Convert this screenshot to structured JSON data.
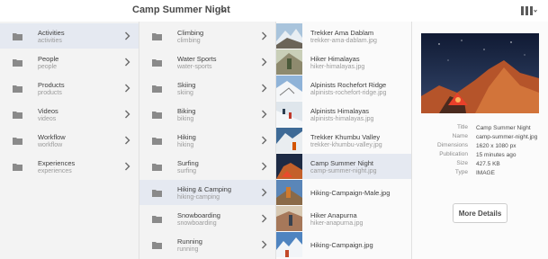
{
  "header": {
    "title": "Camp Summer Night"
  },
  "column1": [
    {
      "title": "Activities",
      "name": "activities",
      "selected": true
    },
    {
      "title": "People",
      "name": "people"
    },
    {
      "title": "Products",
      "name": "products"
    },
    {
      "title": "Videos",
      "name": "videos"
    },
    {
      "title": "Workflow",
      "name": "workflow"
    },
    {
      "title": "Experiences",
      "name": "experiences"
    }
  ],
  "column2": [
    {
      "title": "Climbing",
      "name": "climbing"
    },
    {
      "title": "Water Sports",
      "name": "water-sports"
    },
    {
      "title": "Skiing",
      "name": "skiing"
    },
    {
      "title": "Biking",
      "name": "biking"
    },
    {
      "title": "Hiking",
      "name": "hiking"
    },
    {
      "title": "Surfing",
      "name": "surfing"
    },
    {
      "title": "Hiking & Camping",
      "name": "hiking-camping",
      "selected": true
    },
    {
      "title": "Snowboarding",
      "name": "snowboarding"
    },
    {
      "title": "Running",
      "name": "running"
    }
  ],
  "column3": [
    {
      "title": "Trekker Ama Dablam",
      "name": "trekker-ama-dablam.jpg"
    },
    {
      "title": "Hiker Himalayas",
      "name": "hiker-himalayas.jpg"
    },
    {
      "title": "Alpinists Rochefort Ridge",
      "name": "alpinists-rochefort-ridge.jpg"
    },
    {
      "title": "Alpinists Himalayas",
      "name": "alpinists-himalayas.jpg"
    },
    {
      "title": "Trekker Khumbu Valley",
      "name": "trekker-khumbu-valley.jpg"
    },
    {
      "title": "Camp Summer Night",
      "name": "camp-summer-night.jpg",
      "selected": true
    },
    {
      "title": "Hiking-Campaign-Male.jpg",
      "name": ""
    },
    {
      "title": "Hiker Anapurna",
      "name": "hiker-anapurna.jpg"
    },
    {
      "title": "Hiking-Campaign.jpg",
      "name": ""
    }
  ],
  "details": {
    "labels": {
      "title": "Title",
      "name": "Name",
      "dimensions": "Dimensions",
      "publication": "Publication",
      "size": "Size",
      "type": "Type"
    },
    "values": {
      "title": "Camp Summer Night",
      "name": "camp-summer-night.jpg",
      "dimensions": "1620 x 1080 px",
      "publication": "15 minutes ago",
      "size": "427.5 KB",
      "type": "IMAGE"
    },
    "button": "More Details"
  },
  "colors": {
    "selected_row": "#e5e9f1",
    "column_bg": "#f3f3f3",
    "text": "#4b4b4b",
    "subtext": "#9b9b9b"
  },
  "icons": {
    "folder": "folder-icon",
    "chevron": "chevron-right-icon",
    "view": "column-view-icon"
  }
}
